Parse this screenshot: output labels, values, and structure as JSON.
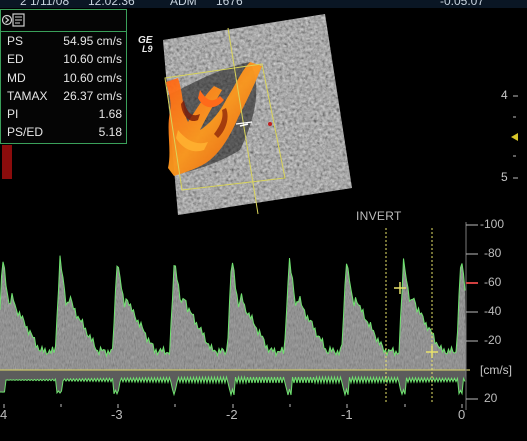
{
  "topbar": {
    "date": "2 1/11/08",
    "time": "12:02:36",
    "mode": "ADM",
    "frame": "1676",
    "offset": "-0.05.07"
  },
  "measurements": [
    {
      "label": "PS",
      "value": "54.95 cm/s"
    },
    {
      "label": "ED",
      "value": "10.60 cm/s"
    },
    {
      "label": "MD",
      "value": "10.60 cm/s"
    },
    {
      "label": "TAMAX",
      "value": "26.37 cm/s"
    },
    {
      "label": "PI",
      "value": "1.68"
    },
    {
      "label": "PS/ED",
      "value": "5.18"
    }
  ],
  "probe": {
    "brand": "GE",
    "model": "L9"
  },
  "invert_label": "INVERT",
  "depth_scale": {
    "ticks": [
      "4",
      "5"
    ]
  },
  "velocity_scale": {
    "unit": "[cm/s]",
    "ticks": [
      "-100",
      "-80",
      "-60",
      "-40",
      "-20",
      "20"
    ],
    "baseline_color": "#c9c46a",
    "marker_color": "#d04040"
  },
  "time_axis": {
    "ticks": [
      "4",
      "-3",
      "-2",
      "-1",
      "0"
    ]
  },
  "colors": {
    "box_border": "#3aa05a",
    "envelope": "#6fe36f",
    "cursor": "#e9e36a"
  }
}
